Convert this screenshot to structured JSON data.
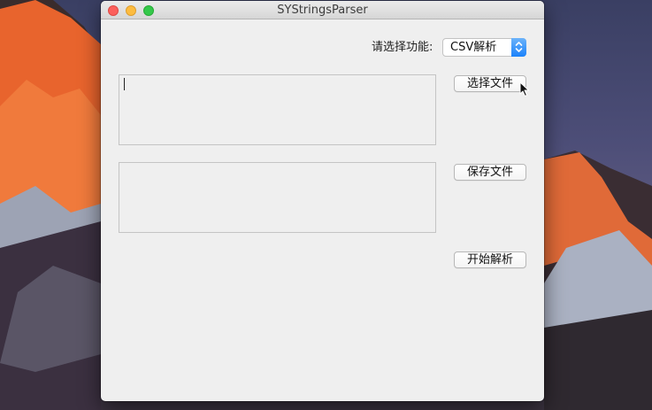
{
  "window": {
    "title": "SYStringsParser"
  },
  "function_selector": {
    "label": "请选择功能:",
    "selected": "CSV解析"
  },
  "buttons": {
    "choose_file": "选择文件",
    "save_file": "保存文件",
    "start_parse": "开始解析"
  },
  "text_fields": {
    "input_path": "",
    "output_path": ""
  },
  "icons": {
    "popup_stepper": "chevron-up-down-icon",
    "cursor": "arrow-pointer-icon"
  },
  "colors": {
    "accent": "#1a82fb",
    "close": "#fc605c",
    "minimize": "#fdbc40",
    "zoom": "#34c84a"
  }
}
